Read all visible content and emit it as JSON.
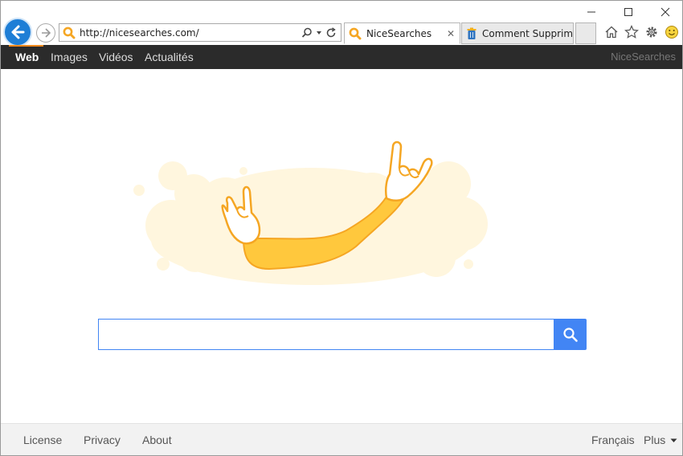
{
  "browser": {
    "url": "http://nicesearches.com/",
    "tabs": [
      {
        "label": "NiceSearches",
        "close": "✕",
        "active": true
      },
      {
        "label": "Comment Supprim...",
        "active": false
      }
    ],
    "icons": {
      "back": "back-arrow-icon",
      "forward": "forward-arrow-icon",
      "search": "search-icon",
      "refresh": "refresh-icon",
      "home": "home-icon",
      "favorites": "star-icon",
      "settings": "gear-icon",
      "feedback": "smiley-icon"
    }
  },
  "navbar": {
    "items": [
      "Web",
      "Images",
      "Vidéos",
      "Actualités"
    ],
    "active_index": 0,
    "brand": "NiceSearches"
  },
  "search": {
    "value": "",
    "placeholder": ""
  },
  "footer": {
    "left": [
      "License",
      "Privacy",
      "About"
    ],
    "language": "Français",
    "more": "Plus"
  },
  "colors": {
    "accent": "#4285f4",
    "nav_bg": "#2b2b2b",
    "nav_active": "#ff8a1d",
    "ie_blue": "#1e7ed6",
    "hero_yellow": "#ffc83d",
    "hero_cloud": "#fff6de"
  }
}
